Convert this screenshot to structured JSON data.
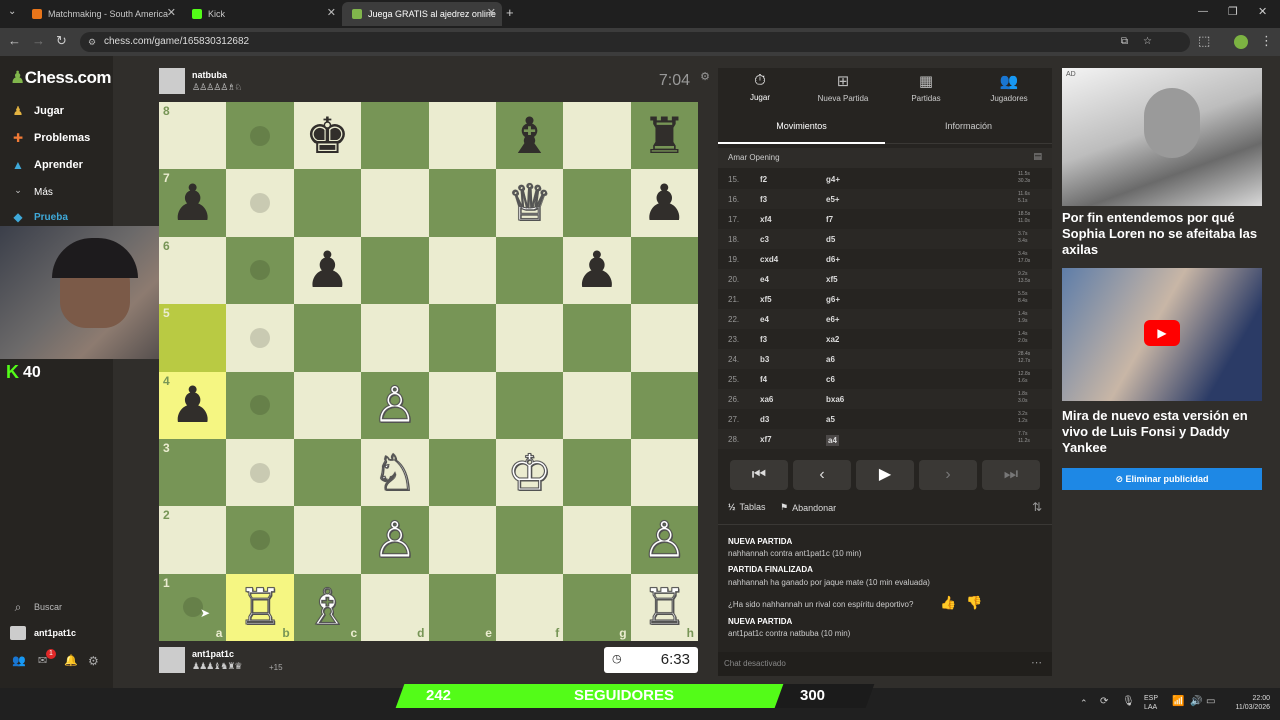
{
  "browser": {
    "tabs": [
      {
        "label": "Matchmaking - South America"
      },
      {
        "label": "Kick"
      },
      {
        "label": "Juega GRATIS al ajedrez online"
      }
    ],
    "url": "chess.com/game/165830312682"
  },
  "sidebar": {
    "logo": "Chess.com",
    "items": [
      {
        "label": "Jugar"
      },
      {
        "label": "Problemas"
      },
      {
        "label": "Aprender"
      },
      {
        "label": "Más"
      },
      {
        "label": "Prueba"
      }
    ],
    "search": "Buscar",
    "user": "ant1pat1c",
    "notif_badge": "1"
  },
  "stream": {
    "kick_count": "40",
    "followers_current": "242",
    "followers_label": "SEGUIDORES",
    "followers_goal": "300"
  },
  "top_player": {
    "name": "natbuba",
    "clock": "7:04"
  },
  "bottom_player": {
    "name": "ant1pat1c",
    "material": "+15",
    "clock": "6:33"
  },
  "board": {
    "ranks": [
      "8",
      "7",
      "6",
      "5",
      "4",
      "3",
      "2",
      "1"
    ],
    "files": [
      "a",
      "b",
      "c",
      "d",
      "e",
      "f",
      "g",
      "h"
    ]
  },
  "panel": {
    "tabs": [
      {
        "label": "Jugar",
        "icon": "stopwatch-icon"
      },
      {
        "label": "Nueva Partida",
        "icon": "plus-icon"
      },
      {
        "label": "Partidas",
        "icon": "board-icon"
      },
      {
        "label": "Jugadores",
        "icon": "players-icon"
      }
    ],
    "subtabs": [
      "Movimientos",
      "Información"
    ],
    "opening": "Amar Opening",
    "moves": [
      {
        "n": "15.",
        "w": "f2",
        "b": "g4+",
        "tw": "11.5s",
        "tb": "30.3s"
      },
      {
        "n": "16.",
        "w": "f3",
        "b": "e5+",
        "tw": "11.6s",
        "tb": "5.1s"
      },
      {
        "n": "17.",
        "w": "xf4",
        "b": "f7",
        "tw": "18.5s",
        "tb": "11.0s"
      },
      {
        "n": "18.",
        "w": "c3",
        "b": "d5",
        "tw": "3.7s",
        "tb": "3.4s"
      },
      {
        "n": "19.",
        "w": "cxd4",
        "b": "d6+",
        "tw": "3.4s",
        "tb": "17.0s"
      },
      {
        "n": "20.",
        "w": "e4",
        "b": "xf5",
        "tw": "9.2s",
        "tb": "13.5s"
      },
      {
        "n": "21.",
        "w": "xf5",
        "b": "g6+",
        "tw": "5.5s",
        "tb": "8.4s"
      },
      {
        "n": "22.",
        "w": "e4",
        "b": "e6+",
        "tw": "1.4s",
        "tb": "1.9s"
      },
      {
        "n": "23.",
        "w": "f3",
        "b": "xa2",
        "tw": "1.4s",
        "tb": "2.0s"
      },
      {
        "n": "24.",
        "w": "b3",
        "b": "a6",
        "tw": "28.4s",
        "tb": "12.7s"
      },
      {
        "n": "25.",
        "w": "f4",
        "b": "c6",
        "tw": "12.8s",
        "tb": "1.6s"
      },
      {
        "n": "26.",
        "w": "xa6",
        "b": "bxa6",
        "tw": "1.8s",
        "tb": "3.0s"
      },
      {
        "n": "27.",
        "w": "d3",
        "b": "a5",
        "tw": "3.2s",
        "tb": "1.2s"
      },
      {
        "n": "28.",
        "w": "xf7",
        "b": "a4",
        "tw": "7.7s",
        "tb": "11.2s"
      }
    ],
    "draw": "Tablas",
    "resign": "Abandonar",
    "log": [
      {
        "title": "NUEVA PARTIDA",
        "text": "nahhannah contra ant1pat1c (10 min)"
      },
      {
        "title": "PARTIDA FINALIZADA",
        "text": "nahhannah ha ganado por jaque mate (10 min evaluada)"
      },
      {
        "title": "",
        "text": "¿Ha sido nahhannah un rival con espíritu deportivo?"
      },
      {
        "title": "NUEVA PARTIDA",
        "text": "ant1pat1c contra natbuba (10 min)"
      }
    ],
    "chat": "Chat desactivado"
  },
  "ads": {
    "tag": "AD",
    "headline1": "Por fin entendemos por qué Sophia Loren no se afeitaba las axilas",
    "headline2": "Mira de nuevo esta versión en vivo de Luis Fonsi y Daddy Yankee",
    "remove": "Eliminar publicidad"
  },
  "taskbar": {
    "lang1": "ESP",
    "lang2": "LAA",
    "time": "22:00",
    "date": "11/03/2026"
  }
}
